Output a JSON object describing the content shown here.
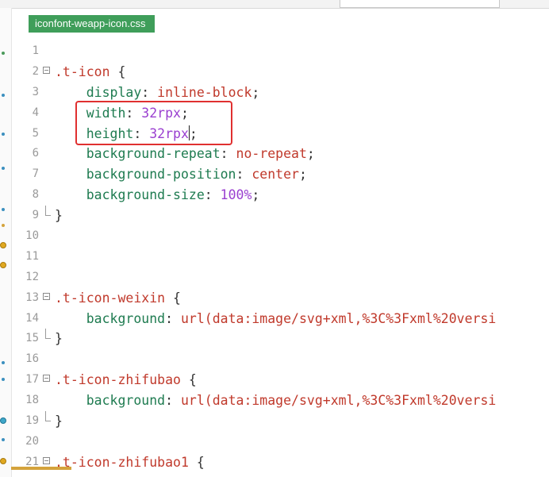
{
  "tab": {
    "label": "iconfont-weapp-icon.css"
  },
  "lines": [
    {
      "n": "1",
      "tokens": []
    },
    {
      "n": "2",
      "fold": "open",
      "tokens": [
        {
          "t": ".t-icon",
          "c": "sel"
        },
        {
          "t": " {",
          "c": "brace"
        }
      ]
    },
    {
      "n": "3",
      "indent": true,
      "tokens": [
        {
          "t": "display",
          "c": "prop"
        },
        {
          "t": ": ",
          "c": "punc"
        },
        {
          "t": "inline-block",
          "c": "val"
        },
        {
          "t": ";",
          "c": "punc"
        }
      ]
    },
    {
      "n": "4",
      "indent": true,
      "tokens": [
        {
          "t": "width",
          "c": "prop"
        },
        {
          "t": ": ",
          "c": "punc"
        },
        {
          "t": "32rpx",
          "c": "num"
        },
        {
          "t": ";",
          "c": "punc"
        }
      ]
    },
    {
      "n": "5",
      "indent": true,
      "caret": true,
      "tokens": [
        {
          "t": "height",
          "c": "prop"
        },
        {
          "t": ": ",
          "c": "punc"
        },
        {
          "t": "32rpx",
          "c": "num"
        },
        {
          "t": "|CARET|",
          "c": "caret"
        },
        {
          "t": ";",
          "c": "punc"
        }
      ]
    },
    {
      "n": "6",
      "indent": true,
      "tokens": [
        {
          "t": "background-repeat",
          "c": "prop"
        },
        {
          "t": ": ",
          "c": "punc"
        },
        {
          "t": "no-repeat",
          "c": "val"
        },
        {
          "t": ";",
          "c": "punc"
        }
      ]
    },
    {
      "n": "7",
      "indent": true,
      "tokens": [
        {
          "t": "background-position",
          "c": "prop"
        },
        {
          "t": ": ",
          "c": "punc"
        },
        {
          "t": "center",
          "c": "val"
        },
        {
          "t": ";",
          "c": "punc"
        }
      ]
    },
    {
      "n": "8",
      "indent": true,
      "tokens": [
        {
          "t": "background-size",
          "c": "prop"
        },
        {
          "t": ": ",
          "c": "punc"
        },
        {
          "t": "100%",
          "c": "num"
        },
        {
          "t": ";",
          "c": "punc"
        }
      ]
    },
    {
      "n": "9",
      "fold": "end",
      "tokens": [
        {
          "t": "}",
          "c": "brace"
        }
      ]
    },
    {
      "n": "10",
      "tokens": []
    },
    {
      "n": "11",
      "tokens": []
    },
    {
      "n": "12",
      "tokens": []
    },
    {
      "n": "13",
      "fold": "open",
      "tokens": [
        {
          "t": ".t-icon-weixin",
          "c": "sel"
        },
        {
          "t": " {",
          "c": "brace"
        }
      ]
    },
    {
      "n": "14",
      "indent": true,
      "tokens": [
        {
          "t": "background",
          "c": "prop"
        },
        {
          "t": ": ",
          "c": "punc"
        },
        {
          "t": "url(data:image/svg+xml,%3C%3Fxml%20versi",
          "c": "val"
        }
      ]
    },
    {
      "n": "15",
      "fold": "end",
      "tokens": [
        {
          "t": "}",
          "c": "brace"
        }
      ]
    },
    {
      "n": "16",
      "tokens": []
    },
    {
      "n": "17",
      "fold": "open",
      "tokens": [
        {
          "t": ".t-icon-zhifubao",
          "c": "sel"
        },
        {
          "t": " {",
          "c": "brace"
        }
      ]
    },
    {
      "n": "18",
      "indent": true,
      "tokens": [
        {
          "t": "background",
          "c": "prop"
        },
        {
          "t": ": ",
          "c": "punc"
        },
        {
          "t": "url(data:image/svg+xml,%3C%3Fxml%20versi",
          "c": "val"
        }
      ]
    },
    {
      "n": "19",
      "fold": "end",
      "tokens": [
        {
          "t": "}",
          "c": "brace"
        }
      ]
    },
    {
      "n": "20",
      "tokens": []
    },
    {
      "n": "21",
      "fold": "open",
      "tokens": [
        {
          "t": ".t-icon-zhifubao1",
          "c": "sel"
        },
        {
          "t": " {",
          "c": "brace"
        }
      ]
    }
  ],
  "colors": {
    "tab_bg": "#3f9e5a",
    "selector": "#c0392b",
    "property": "#1e7b50",
    "number": "#9a3fd0",
    "highlight_box": "#e03030"
  }
}
